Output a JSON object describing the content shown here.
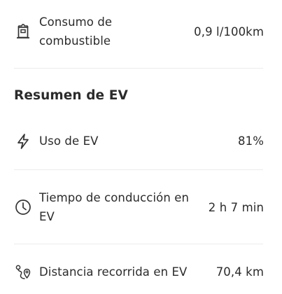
{
  "fuel": {
    "label_line1": "Consumo de",
    "label_line2": "combustible",
    "value": "0,9 l/100km",
    "icon": "fuel-pump-icon"
  },
  "ev_summary": {
    "title": "Resumen de EV",
    "rows": [
      {
        "label": "Uso de EV",
        "value": "81%",
        "icon": "lightning-bolt-icon"
      },
      {
        "label_line1": "Tiempo de conducción en",
        "label_line2": "EV",
        "value": "2 h 7 min",
        "icon": "clock-icon"
      },
      {
        "label": "Distancia recorrida en EV",
        "value": "70,4 km",
        "icon": "route-icon"
      }
    ]
  },
  "colors": {
    "text": "#2b2b2b",
    "divider": "#ececec",
    "background": "#ffffff"
  }
}
